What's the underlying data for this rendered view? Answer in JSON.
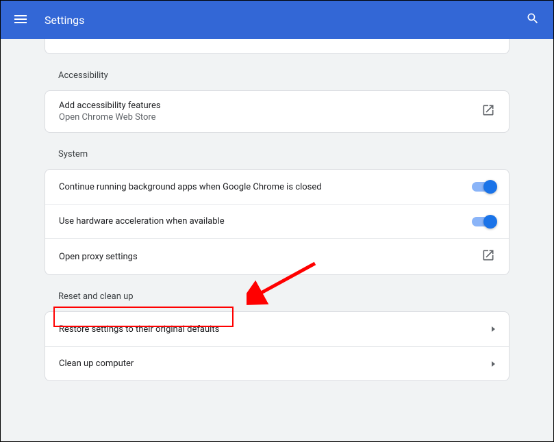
{
  "header": {
    "title": "Settings"
  },
  "sections": {
    "accessibility": {
      "title": "Accessibility",
      "row": {
        "label": "Add accessibility features",
        "sublabel": "Open Chrome Web Store"
      }
    },
    "system": {
      "title": "System",
      "row1": {
        "label": "Continue running background apps when Google Chrome is closed"
      },
      "row2": {
        "label": "Use hardware acceleration when available"
      },
      "row3": {
        "label": "Open proxy settings"
      }
    },
    "reset": {
      "title": "Reset and clean up",
      "row1": {
        "label": "Restore settings to their original defaults"
      },
      "row2": {
        "label": "Clean up computer"
      }
    }
  }
}
